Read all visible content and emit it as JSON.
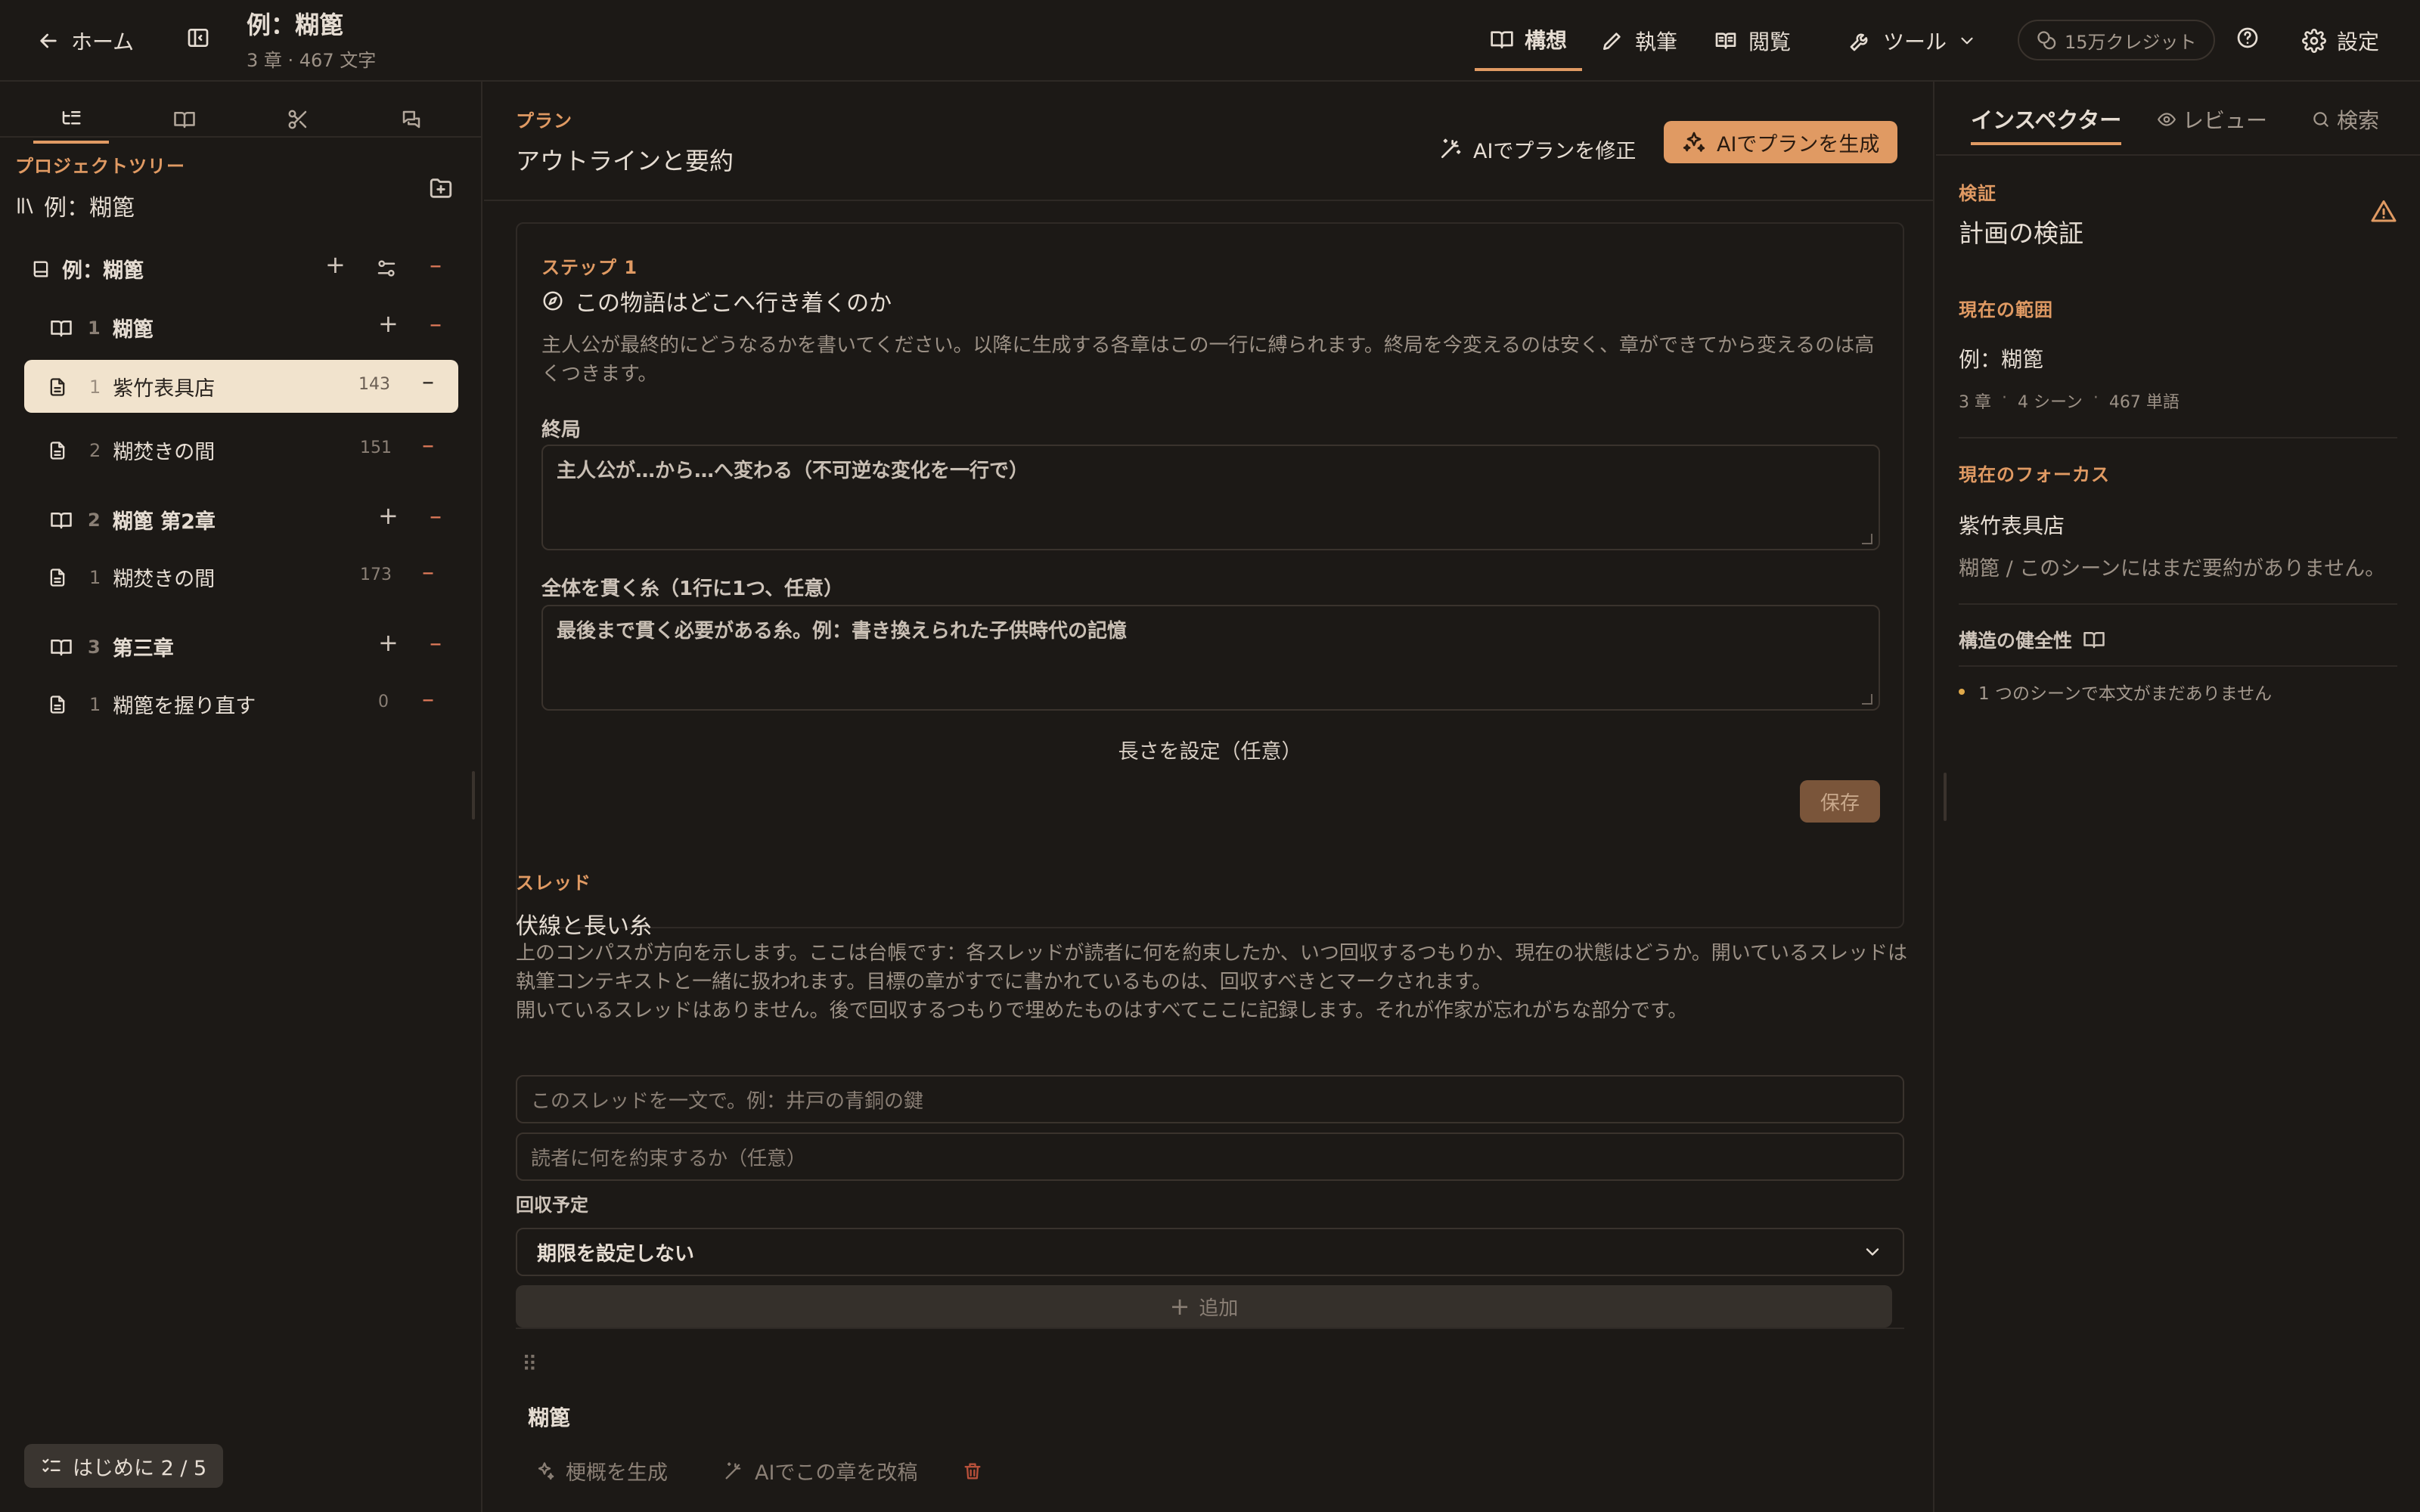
{
  "topbar": {
    "home": "ホーム",
    "project_title": "例：糊篦",
    "project_meta": "3 章 · 467 文字",
    "nav": [
      {
        "label": "構想",
        "icon": "book-open-icon"
      },
      {
        "label": "執筆",
        "icon": "pencil-icon"
      },
      {
        "label": "閲覧",
        "icon": "book-icon"
      }
    ],
    "tools": "ツール",
    "credits": "15万クレジット",
    "settings": "設定"
  },
  "left": {
    "section_label": "プロジェクトツリー",
    "project_name": "例：糊篦",
    "book": "例：糊篦",
    "chapters": [
      {
        "num": "1",
        "title": "糊篦",
        "scenes": [
          {
            "num": "1",
            "title": "紫竹表具店",
            "count": "143",
            "selected": true
          },
          {
            "num": "2",
            "title": "糊焚きの間",
            "count": "151"
          }
        ]
      },
      {
        "num": "2",
        "title": "糊篦 第2章",
        "scenes": [
          {
            "num": "1",
            "title": "糊焚きの間",
            "count": "173"
          }
        ]
      },
      {
        "num": "3",
        "title": "第三章",
        "scenes": [
          {
            "num": "1",
            "title": "糊篦を握り直す",
            "count": "0"
          }
        ]
      }
    ],
    "onboarding": "はじめに 2 / 5"
  },
  "center": {
    "plan_label": "プラン",
    "plan_title": "アウトラインと要約",
    "revise_btn": "AIでプランを修正",
    "generate_btn": "AIでプランを生成",
    "step_label": "ステップ 1",
    "step_title": "この物語はどこへ行き着くのか",
    "step_desc": "主人公が最終的にどうなるかを書いてください。以降に生成する各章はこの一行に縛られます。終局を今変えるのは安く、章ができてから変えるのは高くつきます。",
    "ending_label": "終局",
    "ending_placeholder": "主人公が…から…へ変わる（不可逆な変化を一行で）",
    "threads_field_label": "全体を貫く糸（1行に1つ、任意）",
    "threads_field_placeholder": "最後まで貫く必要がある糸。例：書き換えられた子供時代の記憶",
    "length_link": "長さを設定（任意）",
    "save": "保存",
    "thread_label": "スレッド",
    "thread_title": "伏線と長い糸",
    "thread_desc": "上のコンパスが方向を示します。ここは台帳です：各スレッドが読者に何を約束したか、いつ回収するつもりか、現在の状態はどうか。開いているスレッドは執筆コンテキストと一緒に扱われます。目標の章がすでに書かれているものは、回収すべきとマークされます。",
    "thread_empty": "開いているスレッドはありません。後で回収するつもりで埋めたものはすべてここに記録します。それが作家が忘れがちな部分です。",
    "thread_input_placeholder": "このスレッドを一文で。例：井戸の青銅の鍵",
    "promise_input_placeholder": "読者に何を約束するか（任意）",
    "payoff_label": "回収予定",
    "payoff_value": "期限を設定しない",
    "add_btn": "追加",
    "chapter_card_title": "糊篦",
    "gen_synopsis": "梗概を生成",
    "rewrite_chapter": "AIでこの章を改稿"
  },
  "right": {
    "tabs": [
      "インスペクター",
      "レビュー",
      "検索"
    ],
    "verify_label": "検証",
    "verify_title": "計画の検証",
    "scope_label": "現在の範囲",
    "scope_value": "例：糊篦",
    "scope_meta": [
      "3 章",
      "4 シーン",
      "467 単語"
    ],
    "focus_label": "現在のフォーカス",
    "focus_value": "紫竹表具店",
    "focus_desc": "糊篦 / このシーンにはまだ要約がありません。",
    "health_label": "構造の健全性",
    "health_items": [
      "1 つのシーンで本文がまだありません"
    ]
  },
  "colors": {
    "accent": "#e09a63",
    "background": "#1c1916",
    "selected_row": "#f1e3cd",
    "danger": "#e07a5a"
  }
}
